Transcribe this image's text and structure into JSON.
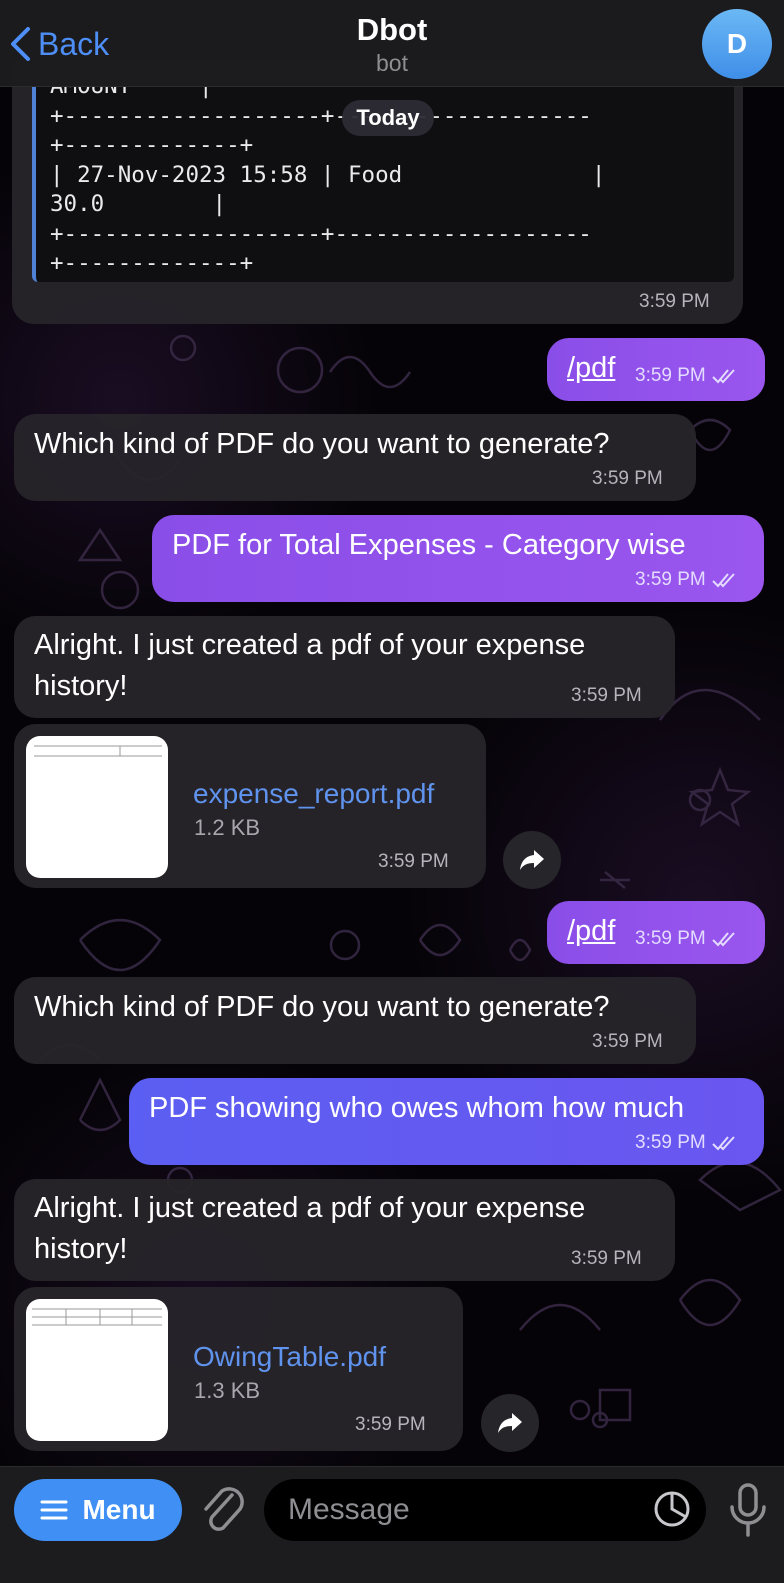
{
  "header": {
    "back_label": "Back",
    "title": "Dbot",
    "subtitle": "bot",
    "avatar_letter": "D"
  },
  "code_block": {
    "lines": [
      "AMOUNT     |",
      "+-------------------+-------------------",
      "+-------------+",
      "| 27-Nov-2023 15:58 | Food              |",
      "30.0        |",
      "+-------------------+-------------------",
      "+-------------+"
    ],
    "time": "3:59 PM"
  },
  "date_separator": "Today",
  "messages": [
    {
      "text": "/pdf",
      "time": "3:59 PM"
    },
    {
      "text": "Which kind of PDF do you want to generate?",
      "time": "3:59 PM"
    },
    {
      "text": "PDF for Total Expenses - Category wise",
      "time": "3:59 PM"
    },
    {
      "text_line1": "Alright. I just created a pdf of your expense",
      "text_line2": "history!",
      "time": "3:59 PM"
    },
    {
      "file_name": "expense_report.pdf",
      "file_size": "1.2 KB",
      "time": "3:59 PM"
    },
    {
      "text": "/pdf",
      "time": "3:59 PM"
    },
    {
      "text": "Which kind of PDF do you want to generate?",
      "time": "3:59 PM"
    },
    {
      "text": "PDF showing who owes whom how much",
      "time": "3:59 PM"
    },
    {
      "text_line1": "Alright. I just created a pdf of your expense",
      "text_line2": "history!",
      "time": "3:59 PM"
    },
    {
      "file_name": "OwingTable.pdf",
      "file_size": "1.3 KB",
      "time": "3:59 PM"
    }
  ],
  "input_bar": {
    "menu_label": "Menu",
    "placeholder": "Message"
  },
  "colors": {
    "accent": "#3f8ff5",
    "outgoing_violet": "#9052eb",
    "outgoing_blue": "#5f5cf2",
    "incoming": "#26242a",
    "link": "#5f93ee"
  },
  "icons": [
    "chevron-left-icon",
    "double-check-icon",
    "forward-icon",
    "hamburger-icon",
    "paperclip-icon",
    "sticker-icon",
    "microphone-icon"
  ]
}
